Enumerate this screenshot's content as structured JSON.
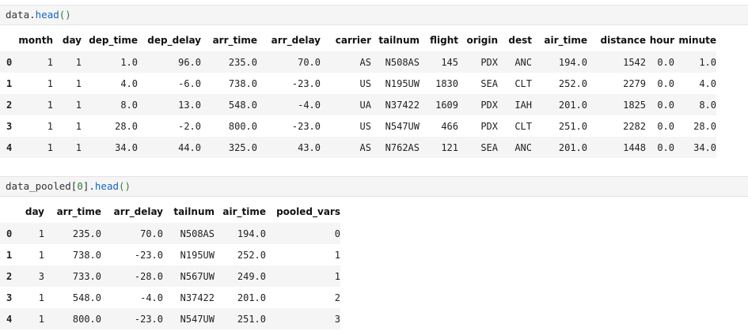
{
  "cells": [
    {
      "code": {
        "obj": "data",
        "dot": ".",
        "method": "head",
        "paren": "()"
      },
      "table": {
        "columns": [
          "",
          "month",
          "day",
          "dep_time",
          "dep_delay",
          "arr_time",
          "arr_delay",
          "carrier",
          "tailnum",
          "flight",
          "origin",
          "dest",
          "air_time",
          "distance",
          "hour",
          "minute"
        ],
        "rows": [
          [
            "0",
            "1",
            "1",
            "1.0",
            "96.0",
            "235.0",
            "70.0",
            "AS",
            "N508AS",
            "145",
            "PDX",
            "ANC",
            "194.0",
            "1542",
            "0.0",
            "1.0"
          ],
          [
            "1",
            "1",
            "1",
            "4.0",
            "-6.0",
            "738.0",
            "-23.0",
            "US",
            "N195UW",
            "1830",
            "SEA",
            "CLT",
            "252.0",
            "2279",
            "0.0",
            "4.0"
          ],
          [
            "2",
            "1",
            "1",
            "8.0",
            "13.0",
            "548.0",
            "-4.0",
            "UA",
            "N37422",
            "1609",
            "PDX",
            "IAH",
            "201.0",
            "1825",
            "0.0",
            "8.0"
          ],
          [
            "3",
            "1",
            "1",
            "28.0",
            "-2.0",
            "800.0",
            "-23.0",
            "US",
            "N547UW",
            "466",
            "PDX",
            "CLT",
            "251.0",
            "2282",
            "0.0",
            "28.0"
          ],
          [
            "4",
            "1",
            "1",
            "34.0",
            "44.0",
            "325.0",
            "43.0",
            "AS",
            "N762AS",
            "121",
            "SEA",
            "ANC",
            "201.0",
            "1448",
            "0.0",
            "34.0"
          ]
        ]
      }
    },
    {
      "code": {
        "obj": "data_pooled[",
        "num": "0",
        "close": "].",
        "method": "head",
        "paren": "()"
      },
      "table": {
        "columns": [
          "",
          "day",
          "arr_time",
          "arr_delay",
          "tailnum",
          "air_time",
          "pooled_vars"
        ],
        "rows": [
          [
            "0",
            "1",
            "235.0",
            "70.0",
            "N508AS",
            "194.0",
            "0"
          ],
          [
            "1",
            "1",
            "738.0",
            "-23.0",
            "N195UW",
            "252.0",
            "1"
          ],
          [
            "2",
            "3",
            "733.0",
            "-28.0",
            "N567UW",
            "249.0",
            "1"
          ],
          [
            "3",
            "1",
            "548.0",
            "-4.0",
            "N37422",
            "201.0",
            "2"
          ],
          [
            "4",
            "1",
            "800.0",
            "-23.0",
            "N547UW",
            "251.0",
            "3"
          ]
        ]
      }
    }
  ]
}
